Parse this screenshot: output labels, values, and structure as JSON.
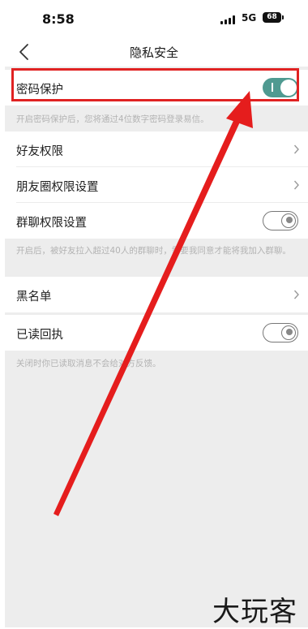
{
  "status_bar": {
    "time": "8:58",
    "network": "5G",
    "battery": "68"
  },
  "nav": {
    "title": "隐私安全",
    "back_icon": "chevron-left-icon"
  },
  "settings": {
    "password_protection": {
      "label": "密码保护",
      "enabled": true,
      "hint": "开启密码保护后，您将通过4位数字密码登录易信。"
    },
    "friend_permissions": {
      "label": "好友权限"
    },
    "moments_permissions": {
      "label": "朋友圈权限设置"
    },
    "group_permissions": {
      "label": "群聊权限设置",
      "enabled": false,
      "hint": "开启后，被好友拉入超过40人的群聊时，需要我同意才能将我加入群聊。"
    },
    "blacklist": {
      "label": "黑名单"
    },
    "read_receipt": {
      "label": "已读回执",
      "enabled": false,
      "hint": "关闭时你已读取消息不会给对方反馈。"
    }
  },
  "annotation": {
    "highlight_color": "#e02222"
  },
  "watermark": "大玩客",
  "colors": {
    "toggle_on": "#4f9a91",
    "background": "#ededed"
  }
}
